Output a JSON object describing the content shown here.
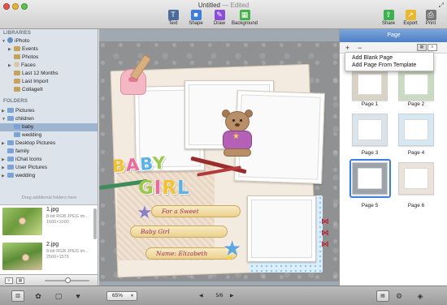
{
  "window": {
    "title": "Untitled",
    "title_sep": "—",
    "title_status": "Edited",
    "fullscreen_icon": "fullscreen-icon"
  },
  "toolbar": {
    "text_label": "Text",
    "shape_label": "Shape",
    "draw_label": "Draw",
    "background_label": "Background",
    "share_label": "Share",
    "export_label": "Export",
    "print_label": "Print"
  },
  "sidebar": {
    "libraries_header": "LIBRARIES",
    "libraries": [
      {
        "label": "iPhoto",
        "icon": "iphoto-icon"
      },
      {
        "label": "Events",
        "icon": "grid-icon"
      },
      {
        "label": "Photos",
        "icon": "grid-icon"
      },
      {
        "label": "Faces",
        "icon": "face-icon"
      },
      {
        "label": "Last 12 Months",
        "icon": "grid-icon"
      },
      {
        "label": "Last Import",
        "icon": "grid-icon"
      },
      {
        "label": "CollageIt",
        "icon": "grid-icon"
      }
    ],
    "folders_header": "FOLDERS",
    "folders": [
      {
        "label": "Pictures",
        "icon": "folder-icon"
      },
      {
        "label": "children",
        "icon": "folder-icon"
      },
      {
        "label": "baby",
        "icon": "folder-icon",
        "selected": true
      },
      {
        "label": "wedding",
        "icon": "folder-icon"
      },
      {
        "label": "Desktop Pictures",
        "icon": "folder-icon"
      },
      {
        "label": "family",
        "icon": "folder-icon"
      },
      {
        "label": "iChat Icons",
        "icon": "folder-icon"
      },
      {
        "label": "User Pictures",
        "icon": "folder-icon"
      },
      {
        "label": "wedding",
        "icon": "folder-icon"
      }
    ],
    "drag_hint": "Drag additional folders here"
  },
  "photos": [
    {
      "name": "1.jpg",
      "meta1": "8-bit RGB JPEG im...",
      "meta2": "1600×1000"
    },
    {
      "name": "2.jpg",
      "meta1": "8-bit RGB JPEG im...",
      "meta2": "2500×1579"
    }
  ],
  "canvas": {
    "title_baby": "BABY",
    "title_girl": "GIRL",
    "banner_1": "For a Sweet",
    "banner_2": "Baby Girl",
    "banner_3": "Name: Elizabeth"
  },
  "page_panel": {
    "header": "Page",
    "add_symbol": "+",
    "remove_symbol": "−",
    "menu": [
      "Add Blank Page",
      "Add Page From Template"
    ],
    "pages": [
      "Page 1",
      "Page 2",
      "Page 3",
      "Page 4",
      "Page 5",
      "Page 6"
    ],
    "selected_page": "Page 5"
  },
  "bottom_bar": {
    "zoom": "65%",
    "page_indicator": "5/6"
  },
  "colors": {
    "accent": "#4e7fc4",
    "selection": "#3a7fe0"
  }
}
